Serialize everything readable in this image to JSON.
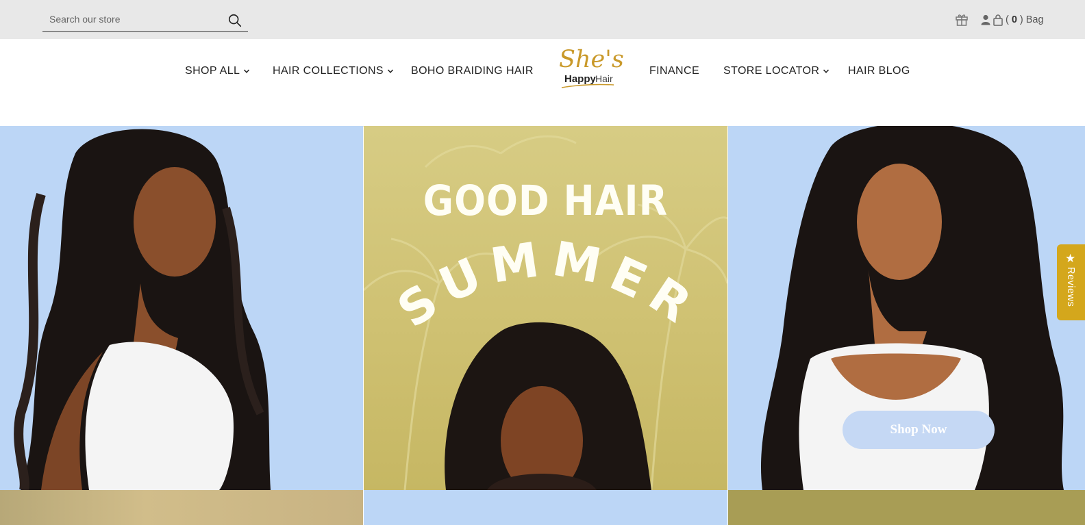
{
  "search": {
    "placeholder": "Search our store"
  },
  "account": {
    "count": "0",
    "bag_label": "Bag"
  },
  "nav": {
    "left": [
      {
        "label": "SHOP ALL",
        "dropdown": true
      },
      {
        "label": "HAIR COLLECTIONS",
        "dropdown": true
      },
      {
        "label": "BOHO BRAIDING HAIR",
        "dropdown": false
      }
    ],
    "right": [
      {
        "label": "FINANCE",
        "dropdown": false
      },
      {
        "label": "STORE LOCATOR",
        "dropdown": true
      },
      {
        "label": "HAIR BLOG",
        "dropdown": false
      }
    ]
  },
  "logo": {
    "text": "She's HappyHair",
    "script": "She's",
    "happy": "Happy",
    "hair": "Hair"
  },
  "hero": {
    "headline": "GOOD HAIR",
    "arc_text": "SUMMER",
    "cta": "Shop Now"
  },
  "reviews_tab": {
    "label": "Reviews"
  },
  "colors": {
    "accent": "#d4a71c",
    "panel_blue": "#bcd6f6",
    "panel_olive": "#cfc172",
    "topbar": "#e8e8e8"
  }
}
